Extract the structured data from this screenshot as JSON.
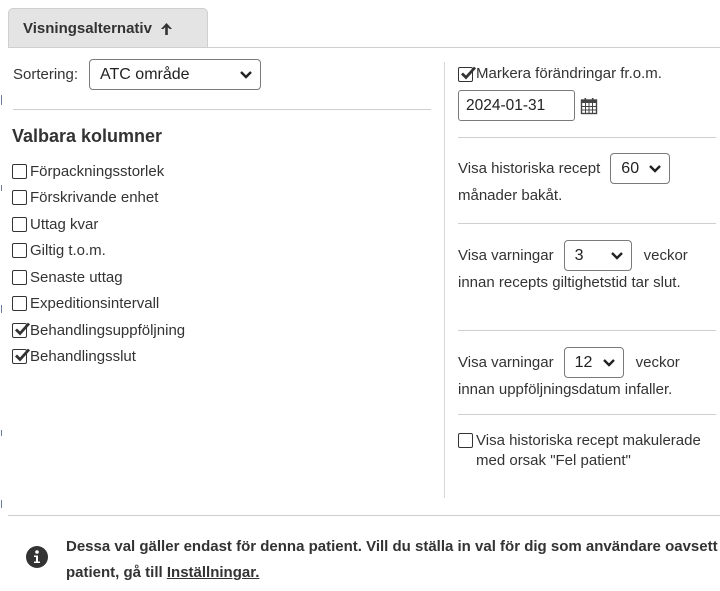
{
  "tab": {
    "label": "Visningsalternativ"
  },
  "sorting": {
    "label": "Sortering:",
    "selected": "ATC område"
  },
  "columns": {
    "title": "Valbara kolumner",
    "items": [
      {
        "label": "Förpackningsstorlek",
        "checked": false
      },
      {
        "label": "Förskrivande enhet",
        "checked": false
      },
      {
        "label": "Uttag kvar",
        "checked": false
      },
      {
        "label": "Giltig t.o.m.",
        "checked": false
      },
      {
        "label": "Senaste uttag",
        "checked": false
      },
      {
        "label": "Expeditionsintervall",
        "checked": false
      },
      {
        "label": "Behandlingsuppföljning",
        "checked": true
      },
      {
        "label": "Behandlingsslut",
        "checked": true
      }
    ]
  },
  "markChanges": {
    "label": "Markera förändringar fr.o.m.",
    "checked": true,
    "date": "2024-01-31"
  },
  "historical": {
    "prefix": "Visa historiska recept",
    "value": "60",
    "suffix": "månader bakåt."
  },
  "warn1": {
    "prefix": "Visa varningar",
    "value": "3",
    "unit": "veckor",
    "suffix": "innan recepts giltighetstid tar slut."
  },
  "warn2": {
    "prefix": "Visa varningar",
    "value": "12",
    "unit": "veckor",
    "suffix": "innan uppföljningsdatum infaller."
  },
  "cancelled": {
    "label": "Visa historiska recept makulerade med orsak \"Fel patient\"",
    "checked": false
  },
  "info": {
    "text": "Dessa val gäller endast för denna patient. Vill du ställa in val för dig som användare oavsett patient, gå till",
    "link": "Inställningar."
  },
  "colors": {
    "text": "#333333",
    "border": "#cfcfcf",
    "tab": "#e4e4e4"
  }
}
